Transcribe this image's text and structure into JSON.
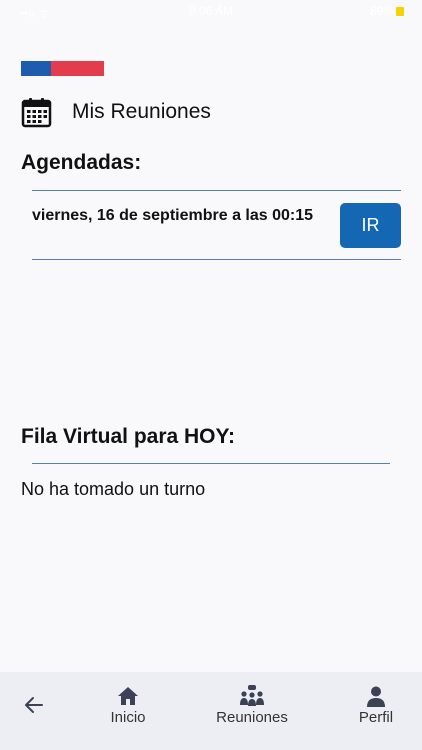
{
  "status_bar": {
    "left": "••ıı ᯤ",
    "time": "9:06 AM",
    "battery_text": "89%"
  },
  "colors": {
    "flag_blue": "#1d5cae",
    "flag_red": "#e33c4c",
    "accent_button": "#1467b3",
    "divider": "#5b7fab",
    "tab_icon": "#3b4256"
  },
  "header": {
    "icon": "calendar-icon",
    "title": "Mis Reuniones"
  },
  "scheduled": {
    "title": "Agendadas:",
    "meetings": [
      {
        "text": "viernes, 16 de septiembre a las 00:15",
        "button_label": "IR"
      }
    ]
  },
  "virtual_queue": {
    "title": "Fila Virtual para HOY:",
    "empty_text": "No ha tomado un turno"
  },
  "tabbar": {
    "back_icon": "back-arrow-icon",
    "tabs": [
      {
        "label": "Inicio",
        "icon": "home-icon"
      },
      {
        "label": "Reuniones",
        "icon": "meeting-people-icon"
      },
      {
        "label": "Perfil",
        "icon": "person-icon"
      }
    ]
  }
}
